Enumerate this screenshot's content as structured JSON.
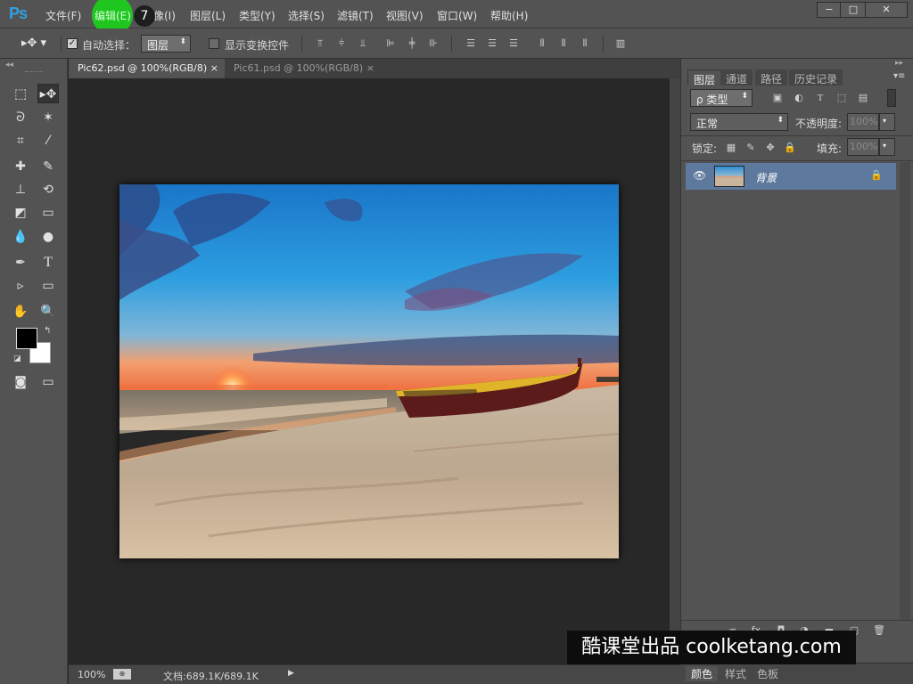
{
  "app": {
    "logo": "Ps"
  },
  "menu": [
    {
      "label": "文件(F)"
    },
    {
      "label": "编辑(E)"
    },
    {
      "label": "图像(I)"
    },
    {
      "label": "图层(L)"
    },
    {
      "label": "类型(Y)"
    },
    {
      "label": "选择(S)"
    },
    {
      "label": "滤镜(T)"
    },
    {
      "label": "视图(V)"
    },
    {
      "label": "窗口(W)"
    },
    {
      "label": "帮助(H)"
    }
  ],
  "step_badge": "7",
  "window_controls": {
    "minimize": "−",
    "restore": "□",
    "close": "✕"
  },
  "options": {
    "auto_select_label": "自动选择：",
    "auto_select_checked": true,
    "target_value": "图层",
    "show_transform_label": "显示变换控件"
  },
  "tabs": [
    {
      "label": "Pic62.psd @ 100%(RGB/8)",
      "close": "×",
      "active": true
    },
    {
      "label": "Pic61.psd @ 100%(RGB/8)",
      "close": "×",
      "active": false
    }
  ],
  "status": {
    "zoom": "100%",
    "doc": "文档:689.1K/689.1K",
    "arrow": "▶"
  },
  "panel": {
    "tabs": [
      "图层",
      "通道",
      "路径",
      "历史记录"
    ],
    "filter_kind": "ρ 类型",
    "blend_mode": "正常",
    "opacity_label": "不透明度:",
    "opacity_value": "100%",
    "lock_label": "锁定:",
    "fill_label": "填充:",
    "fill_value": "100%",
    "layer_name": "背景"
  },
  "bottom_tabs": [
    "颜色",
    "样式",
    "色板"
  ],
  "watermark": "酷课堂出品 coolketang.com",
  "colors": {
    "accent_blue": "#2fa1e0",
    "highlight_green": "#1fc61f",
    "layer_selected": "#5d7a9e"
  }
}
